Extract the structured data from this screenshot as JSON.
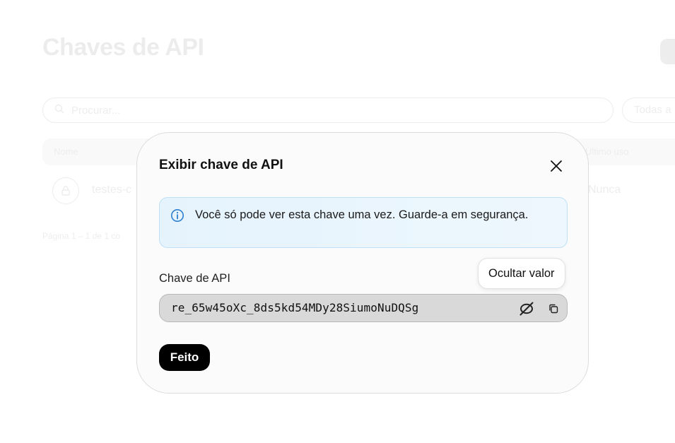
{
  "background": {
    "page_title": "Chaves de API",
    "search_placeholder": "Procurar...",
    "filter_label": "Todas a",
    "table_headers": {
      "name": "Nome",
      "last_use": "Último uso"
    },
    "rows": [
      {
        "name": "testes-c",
        "last_use": "Nunca"
      }
    ],
    "pagination": "Página 1 – 1 de 1 co"
  },
  "modal": {
    "title": "Exibir chave de API",
    "info_message": "Você só pode ver esta chave uma vez. Guarde-a em segurança.",
    "field_label": "Chave de API",
    "api_key_value": "re_65w45oXc_8ds5kd54MDy28SiumoNuDQSg",
    "tooltip": "Ocultar valor",
    "done_label": "Feito"
  },
  "icons": {
    "search": "search-icon",
    "lock": "lock-icon",
    "close": "close-icon",
    "info": "info-icon",
    "eye_off": "eye-off-icon",
    "copy": "copy-icon"
  },
  "colors": {
    "info_background": "#e5f3fd",
    "info_border": "#bfe0f7",
    "info_icon": "#2b7fcf",
    "primary_button": "#000000"
  }
}
